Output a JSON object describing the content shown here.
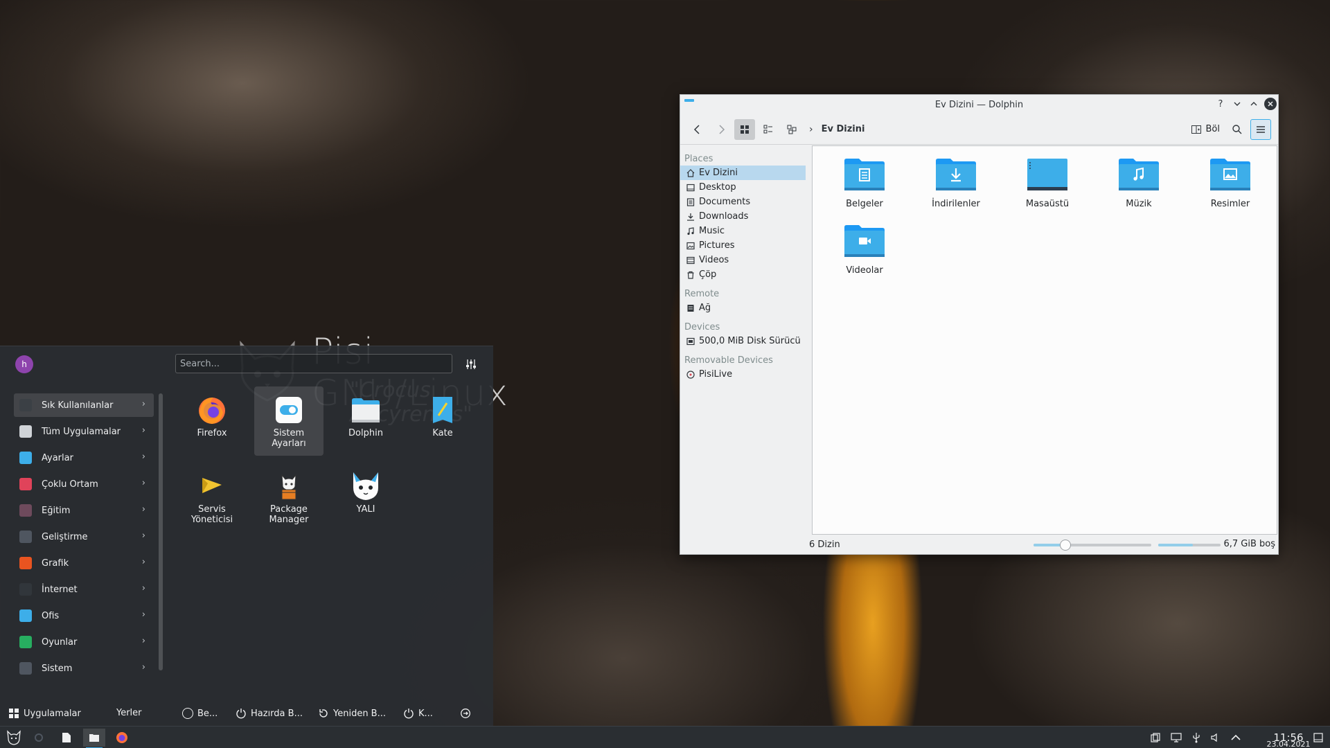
{
  "desktop": {
    "brand_title": "Pisi GNU/Linux",
    "brand_subtitle": "\"Crocus Ancyrensis\""
  },
  "dolphin": {
    "title": "Ev Dizini — Dolphin",
    "breadcrumb": "Ev Dizini",
    "split_label": "Böl",
    "help": "?",
    "places": {
      "heading": "Places",
      "items": [
        "Ev Dizini",
        "Desktop",
        "Documents",
        "Downloads",
        "Music",
        "Pictures",
        "Videos",
        "Çöp"
      ]
    },
    "remote": {
      "heading": "Remote",
      "items": [
        "Ağ"
      ]
    },
    "devices": {
      "heading": "Devices",
      "items": [
        "500,0 MiB Disk Sürücü"
      ]
    },
    "removable": {
      "heading": "Removable Devices",
      "items": [
        "PisiLive"
      ]
    },
    "folders": [
      "Belgeler",
      "İndirilenler",
      "Masaüstü",
      "Müzik",
      "Resimler",
      "Videolar"
    ],
    "status": {
      "summary": "6 Dizin",
      "free_space": "6,7 GiB boş",
      "zoom_level": 0.27,
      "disk_used_fraction": 0.55
    }
  },
  "launcher": {
    "avatar_initial": "h",
    "search_placeholder": "Search...",
    "categories": [
      {
        "label": "Sık Kullanılanlar",
        "icon": "star-icon",
        "color": "#3b4045"
      },
      {
        "label": "Tüm Uygulamalar",
        "icon": "document-icon",
        "color": "#d0d4d8"
      },
      {
        "label": "Ayarlar",
        "icon": "settings-icon",
        "color": "#3daee9"
      },
      {
        "label": "Çoklu Ortam",
        "icon": "music-icon",
        "color": "#e0435a"
      },
      {
        "label": "Eğitim",
        "icon": "education-icon",
        "color": "#6e4a5c"
      },
      {
        "label": "Geliştirme",
        "icon": "gear-icon",
        "color": "#4f5660"
      },
      {
        "label": "Grafik",
        "icon": "color-wheel-icon",
        "color": "#e95420"
      },
      {
        "label": "İnternet",
        "icon": "network-icon",
        "color": "#31363b"
      },
      {
        "label": "Ofis",
        "icon": "office-icon",
        "color": "#3daee9"
      },
      {
        "label": "Oyunlar",
        "icon": "game-icon",
        "color": "#27ae60"
      },
      {
        "label": "Sistem",
        "icon": "system-icon",
        "color": "#4f5660"
      }
    ],
    "apps": [
      {
        "label": "Firefox",
        "icon": "firefox-icon"
      },
      {
        "label": "Sistem Ayarları",
        "icon": "toggle-icon"
      },
      {
        "label": "Dolphin",
        "icon": "folder-icon"
      },
      {
        "label": "Kate",
        "icon": "kate-icon"
      },
      {
        "label": "Servis Yöneticisi",
        "icon": "service-icon"
      },
      {
        "label": "Package Manager",
        "icon": "package-icon"
      },
      {
        "label": "YALI",
        "icon": "cat-icon"
      }
    ],
    "footer": {
      "tab_apps": "Uygulamalar",
      "tab_places": "Yerler",
      "action_1": "Be...",
      "action_2": "Hazırda B...",
      "action_3": "Yeniden B...",
      "action_4": "K..."
    }
  },
  "taskbar": {
    "time": "11:56",
    "date": "23.04.2021"
  }
}
